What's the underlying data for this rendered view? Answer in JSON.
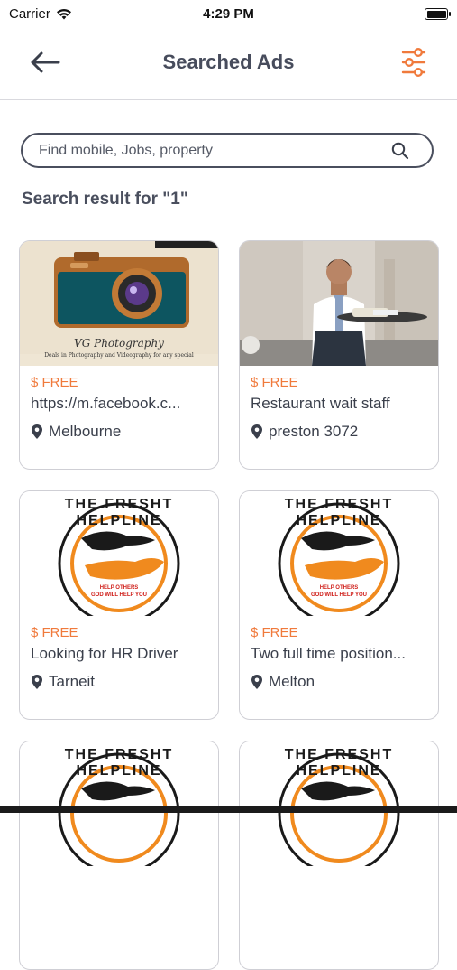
{
  "status": {
    "carrier": "Carrier",
    "time": "4:29 PM"
  },
  "header": {
    "title": "Searched Ads"
  },
  "search": {
    "placeholder": "Find mobile, Jobs, property"
  },
  "results_heading": "Search result for \"1\"",
  "listings": [
    {
      "price": "$ FREE",
      "title": "https://m.facebook.c...",
      "location": "Melbourne",
      "image": "camera-photography",
      "image_text": "VG Photography",
      "image_subtext": "Deals in Photography and Videography for any special"
    },
    {
      "price": "$ FREE",
      "title": "Restaurant wait staff",
      "location": "preston 3072",
      "image": "waitress-photo"
    },
    {
      "price": "$ FREE",
      "title": "Looking for HR Driver",
      "location": "Tarneit",
      "image": "fresh-helpline-logo"
    },
    {
      "price": "$ FREE",
      "title": "Two full time position...",
      "location": "Melton",
      "image": "fresh-helpline-logo"
    },
    {
      "image": "fresh-helpline-logo"
    },
    {
      "image": "fresh-helpline-logo"
    }
  ],
  "logo": {
    "ring_text": "THE FRESHT HELPLINE",
    "line1": "HELP OTHERS",
    "line2": "GOD WILL HELP YOU"
  },
  "colors": {
    "accent": "#f07a3c",
    "text": "#3a3f4b",
    "border": "#cfcfd5"
  }
}
